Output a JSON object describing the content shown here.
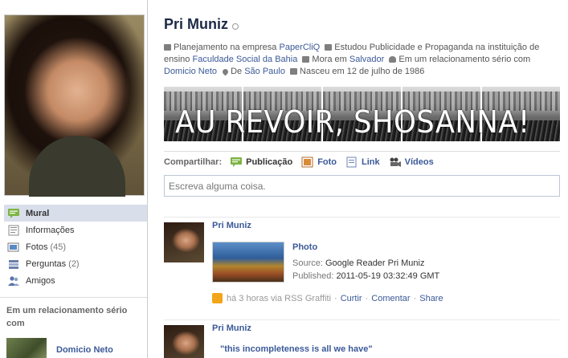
{
  "profile": {
    "name": "Pri Muniz",
    "info": {
      "work_prefix": "Planejamento na empresa",
      "work_company": "PaperCliQ",
      "study_prefix": "Estudou Publicidade e Propaganda na instituição de ensino",
      "study_school": "Faculdade Social da Bahia",
      "lives_prefix": "Mora em",
      "lives_city": "Salvador",
      "relationship_prefix": "Em um relacionamento sério com",
      "relationship_partner": "Domicio Neto",
      "from_prefix": "De",
      "from_city": "São Paulo",
      "birthday": "Nasceu em 12 de julho de 1986"
    },
    "banner_text": "AU REVOIR, SHOSANNA!"
  },
  "left_nav": [
    {
      "label": "Mural",
      "count": "",
      "icon": "wall-icon"
    },
    {
      "label": "Informações",
      "count": "",
      "icon": "info-icon"
    },
    {
      "label": "Fotos",
      "count": "(45)",
      "icon": "photos-icon"
    },
    {
      "label": "Perguntas",
      "count": "(2)",
      "icon": "questions-icon"
    },
    {
      "label": "Amigos",
      "count": "",
      "icon": "friends-icon"
    }
  ],
  "relationship_box": {
    "title": "Em um relacionamento sério com",
    "partner": "Domicio Neto"
  },
  "share": {
    "label": "Compartilhar:",
    "options": [
      "Publicação",
      "Foto",
      "Link",
      "Vídeos"
    ],
    "placeholder": "Escreva alguma coisa."
  },
  "stories": [
    {
      "author": "Pri Muniz",
      "attachment_title": "Photo",
      "source_label": "Source:",
      "source_value": "Google Reader Pri Muniz",
      "published_label": "Published:",
      "published_value": "2011-05-19 03:32:49 GMT",
      "time": "há 3 horas via RSS Graffiti",
      "actions": [
        "Curtir",
        "Comentar",
        "Share"
      ]
    },
    {
      "author": "Pri Muniz",
      "quote": "\"this incompleteness is all we have\""
    }
  ],
  "colors": {
    "link": "#3b5998",
    "nav_active_bg": "#d8dfea",
    "border": "#bdc7d8"
  }
}
